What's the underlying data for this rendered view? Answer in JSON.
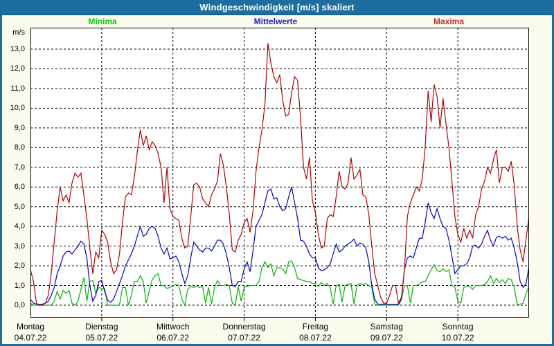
{
  "window": {
    "title": "Windgeschwindigkeit [m/s] skaliert"
  },
  "legend": {
    "items": [
      {
        "label": "Minima",
        "color": "#00cc00"
      },
      {
        "label": "Mittelwerte",
        "color": "#2020cc"
      },
      {
        "label": "Maxima",
        "color": "#c03030"
      }
    ]
  },
  "y_axis": {
    "unit": "m/s",
    "tick_labels": [
      "13,0",
      "12,0",
      "11,0",
      "10,0",
      "9,0",
      "8,0",
      "7,0",
      "6,0",
      "5,0",
      "4,0",
      "3,0",
      "2,0",
      "1,0",
      "0,0"
    ],
    "min": 0,
    "max": 13
  },
  "x_axis": {
    "days": [
      {
        "name": "Montag",
        "date": "04.07.22"
      },
      {
        "name": "Dienstag",
        "date": "05.07.22"
      },
      {
        "name": "Mittwoch",
        "date": "06.07.22"
      },
      {
        "name": "Donnerstag",
        "date": "07.07.22"
      },
      {
        "name": "Freitag",
        "date": "08.07.22"
      },
      {
        "name": "Samstag",
        "date": "09.07.22"
      },
      {
        "name": "Sonntag",
        "date": "10.07.22"
      }
    ]
  },
  "colors": {
    "titlebar": "#1d6da1",
    "background": "#fbfbee",
    "plot_background": "#ffffff",
    "grid": "#000000"
  },
  "chart_data": {
    "type": "line",
    "title": "Windgeschwindigkeit [m/s] skaliert",
    "ylabel": "m/s",
    "ylim": [
      0,
      13
    ],
    "grid": true,
    "legend_position": "top",
    "x_unit": "hours from Mon 04.07.22 00:00 (hourly samples, 7 days)",
    "x_range_hours": [
      0,
      168
    ],
    "series": [
      {
        "name": "Minima",
        "color": "#00b400",
        "values": [
          0.1,
          0,
          0,
          0,
          0,
          0,
          0,
          0,
          0.2,
          0.7,
          0.3,
          0.75,
          0.6,
          0.75,
          0.1,
          0,
          0.2,
          0.8,
          1.4,
          0.2,
          1.2,
          1.25,
          0.6,
          0.9,
          0.85,
          0.85,
          0,
          0,
          0,
          0,
          0,
          0.9,
          0.9,
          0,
          0.5,
          1.2,
          1.2,
          1.5,
          1.2,
          0.1,
          0.7,
          1.3,
          1.5,
          1.6,
          1.0,
          1.0,
          0.85,
          0.9,
          1.0,
          1.05,
          1.0,
          0.3,
          0,
          0.8,
          0.95,
          0.9,
          0.95,
          0.9,
          0.95,
          0.1,
          0.9,
          0.05,
          0.9,
          1.25,
          1.0,
          1.0,
          1.05,
          1.0,
          0.1,
          0,
          0.95,
          0.2,
          0.9,
          0.95,
          1.0,
          1.0,
          1.0,
          1.2,
          1.9,
          2.2,
          1.9,
          2.1,
          1.5,
          1.9,
          1.9,
          1.85,
          1.6,
          2.2,
          2.25,
          1.9,
          1.35,
          1.3,
          1.25,
          1.2,
          1.2,
          1.1,
          1.1,
          0.95,
          1.15,
          1.0,
          1.1,
          0.9,
          0.05,
          1.0,
          1.05,
          0.15,
          1.0,
          1.05,
          1.1,
          0.05,
          1.0,
          1.1,
          1.05,
          1.1,
          1.0,
          0.9,
          0.05,
          0,
          0,
          0,
          0,
          0,
          0,
          0,
          0,
          0.3,
          1.0,
          1.0,
          0.1,
          1.0,
          1.0,
          1.05,
          1.2,
          1.2,
          1.5,
          1.8,
          2.05,
          1.75,
          1.7,
          1.85,
          1.7,
          1.8,
          1.0,
          0.9,
          0.2,
          0.1,
          0.9,
          0.95,
          0.95,
          0.8,
          1.0,
          1.0,
          1.0,
          1.05,
          1.2,
          1.5,
          1.1,
          1.35,
          1.15,
          1.3,
          1.1,
          1.35,
          1.3,
          0.9,
          0.05,
          0.05,
          0.1,
          0.6,
          0.95
        ]
      },
      {
        "name": "Mittelwerte",
        "color": "#0000c8",
        "values": [
          0.3,
          0.1,
          0.05,
          0.05,
          0.05,
          0.1,
          0.2,
          0.5,
          0.9,
          1.6,
          2.0,
          2.5,
          2.7,
          2.75,
          2.6,
          2.8,
          3.0,
          3.25,
          3.1,
          2.4,
          1.0,
          0.2,
          0.5,
          1.2,
          1.25,
          0.7,
          0.25,
          0.15,
          0.3,
          0.7,
          1.1,
          1.5,
          2.0,
          2.3,
          2.6,
          3.0,
          3.5,
          4.0,
          3.5,
          3.6,
          3.9,
          4.0,
          3.9,
          3.5,
          2.9,
          2.6,
          2.9,
          2.35,
          2.4,
          2.5,
          2.2,
          1.6,
          1.1,
          1.5,
          2.4,
          3.2,
          3.0,
          2.8,
          2.7,
          2.9,
          2.9,
          2.75,
          3.0,
          3.3,
          3.3,
          3.1,
          2.6,
          1.9,
          1.0,
          0.95,
          1.2,
          1.2,
          1.85,
          2.2,
          1.7,
          2.8,
          4.0,
          4.3,
          4.6,
          5.2,
          5.8,
          5.9,
          5.4,
          5.45,
          5.0,
          4.8,
          4.9,
          5.5,
          6.0,
          5.2,
          4.4,
          3.3,
          3.25,
          3.0,
          2.6,
          2.4,
          2.4,
          1.9,
          1.75,
          1.8,
          1.9,
          2.1,
          2.6,
          3.1,
          2.7,
          2.8,
          3.0,
          3.1,
          3.2,
          3.35,
          3.0,
          3.15,
          3.1,
          2.9,
          2.2,
          1.0,
          0.3,
          0.06,
          0.05,
          0.05,
          0.05,
          0.05,
          0.05,
          0.05,
          0.05,
          0.3,
          1.8,
          2.4,
          2.5,
          2.4,
          2.9,
          3.4,
          3.4,
          4.2,
          5.2,
          4.7,
          4.4,
          4.9,
          4.4,
          4.0,
          3.9,
          3.3,
          2.5,
          1.6,
          1.8,
          2.0,
          2.0,
          2.1,
          2.4,
          3.0,
          3.05,
          2.9,
          3.1,
          3.5,
          3.8,
          3.3,
          3.0,
          3.45,
          3.5,
          3.4,
          3.5,
          3.3,
          3.4,
          2.9,
          2.2,
          1.2,
          0.9,
          1.1,
          2.0
        ]
      },
      {
        "name": "Maxima",
        "color": "#b00000",
        "values": [
          1.8,
          1.2,
          0.1,
          0,
          0,
          0.1,
          0.5,
          1.6,
          3.2,
          4.8,
          6.0,
          5.3,
          5.6,
          5.2,
          6.2,
          6.7,
          6.5,
          6.7,
          5.6,
          4.4,
          2.9,
          1.6,
          2.7,
          2.4,
          3.8,
          3.6,
          3.2,
          2.2,
          1.6,
          1.8,
          2.6,
          4.2,
          5.5,
          5.7,
          5.6,
          6.5,
          7.8,
          8.9,
          8.1,
          8.6,
          7.9,
          8.3,
          8.1,
          7.7,
          7.0,
          5.2,
          7.0,
          4.9,
          4.5,
          4.4,
          4.3,
          3.4,
          2.9,
          3.0,
          4.5,
          6.1,
          6.2,
          6.0,
          5.4,
          5.2,
          5.0,
          5.6,
          5.9,
          6.3,
          7.7,
          7.1,
          6.0,
          4.6,
          2.8,
          2.7,
          3.3,
          3.6,
          4.2,
          4.4,
          3.7,
          4.8,
          6.8,
          8.0,
          8.9,
          10.2,
          13.3,
          12.3,
          11.6,
          11.3,
          11.7,
          10.4,
          9.6,
          9.7,
          10.8,
          11.6,
          11.4,
          9.5,
          7.0,
          6.4,
          7.5,
          5.3,
          4.7,
          3.6,
          2.9,
          3.0,
          4.4,
          4.6,
          4.5,
          5.5,
          6.8,
          6.0,
          5.9,
          6.2,
          7.5,
          6.4,
          6.6,
          6.9,
          5.6,
          5.5,
          4.6,
          3.0,
          1.6,
          1.0,
          0.4,
          0.1,
          0.1,
          0.5,
          1.0,
          1.0,
          0.1,
          0.4,
          1.8,
          4.5,
          5.2,
          5.6,
          6.0,
          5.8,
          6.4,
          8.0,
          10.9,
          9.3,
          11.2,
          10.6,
          9.0,
          10.5,
          9.2,
          8.0,
          6.3,
          4.5,
          3.6,
          3.2,
          3.9,
          3.4,
          3.8,
          3.4,
          4.6,
          5.0,
          5.9,
          6.3,
          7.0,
          6.7,
          7.4,
          7.9,
          6.2,
          7.0,
          7.0,
          6.8,
          7.3,
          6.1,
          4.0,
          2.8,
          2.2,
          3.4,
          4.5
        ]
      }
    ]
  }
}
